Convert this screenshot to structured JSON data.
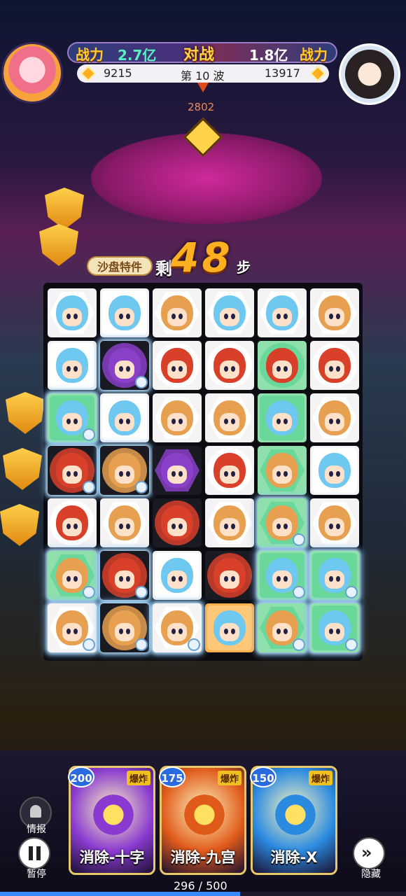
{
  "hud": {
    "player_power_label": "战力",
    "player_power_value": "2.7亿",
    "vs_label": "对战",
    "enemy_power_value": "1.8亿",
    "enemy_power_label": "战力",
    "player_score": "9215",
    "wave_label": "第 10 波",
    "enemy_score": "13917",
    "wave_subvalue": "2802"
  },
  "steps": {
    "tag_label": "沙盘特件",
    "prefix": "剩",
    "count": "48",
    "suffix": "步"
  },
  "board": {
    "rows": 7,
    "cols": 6,
    "tiles": [
      [
        {
          "char": "blue-girl",
          "bg": "hex",
          "tile": "white"
        },
        {
          "char": "blue-girl",
          "bg": "square",
          "tile": "white"
        },
        {
          "char": "monkey",
          "bg": "hex",
          "tile": "white"
        },
        {
          "char": "blue-girl",
          "bg": "hex",
          "tile": "white"
        },
        {
          "char": "blue-girl",
          "bg": "hex",
          "tile": "white"
        },
        {
          "char": "monkey",
          "bg": "hex",
          "tile": "white"
        }
      ],
      [
        {
          "char": "blue-girl",
          "bg": "square",
          "tile": "white"
        },
        {
          "char": "purple-knight",
          "bg": "circle",
          "tile": "dark",
          "special": true
        },
        {
          "char": "red-boy",
          "bg": "circle",
          "tile": "white"
        },
        {
          "char": "red-boy",
          "bg": "circle",
          "tile": "white"
        },
        {
          "char": "red-boy",
          "bg": "circle",
          "tile": "green"
        },
        {
          "char": "red-boy",
          "bg": "circle",
          "tile": "white"
        }
      ],
      [
        {
          "char": "blue-girl",
          "bg": "square",
          "tile": "green",
          "special": true
        },
        {
          "char": "blue-girl",
          "bg": "square",
          "tile": "white"
        },
        {
          "char": "monkey",
          "bg": "hex",
          "tile": "white"
        },
        {
          "char": "monkey",
          "bg": "hex",
          "tile": "white"
        },
        {
          "char": "blue-girl",
          "bg": "square",
          "tile": "green"
        },
        {
          "char": "monkey",
          "bg": "hex",
          "tile": "white"
        }
      ],
      [
        {
          "char": "red-boy",
          "bg": "circle",
          "tile": "dark",
          "special": true
        },
        {
          "char": "monkey",
          "bg": "circle",
          "tile": "dark",
          "special": true
        },
        {
          "char": "purple-knight",
          "bg": "hex",
          "tile": "dark"
        },
        {
          "char": "red-boy",
          "bg": "circle",
          "tile": "white"
        },
        {
          "char": "monkey",
          "bg": "hex",
          "tile": "green"
        },
        {
          "char": "blue-girl",
          "bg": "square",
          "tile": "white"
        }
      ],
      [
        {
          "char": "red-boy",
          "bg": "circle",
          "tile": "white"
        },
        {
          "char": "monkey",
          "bg": "hex",
          "tile": "white"
        },
        {
          "char": "red-boy",
          "bg": "circle",
          "tile": "dark"
        },
        {
          "char": "monkey",
          "bg": "hex",
          "tile": "white"
        },
        {
          "char": "monkey",
          "bg": "hex",
          "tile": "green",
          "special": true
        },
        {
          "char": "monkey",
          "bg": "hex",
          "tile": "white"
        }
      ],
      [
        {
          "char": "monkey",
          "bg": "hex",
          "tile": "green",
          "special": true
        },
        {
          "char": "red-boy",
          "bg": "circle",
          "tile": "dark",
          "special": true
        },
        {
          "char": "blue-girl",
          "bg": "square",
          "tile": "white"
        },
        {
          "char": "red-boy",
          "bg": "circle",
          "tile": "dark"
        },
        {
          "char": "blue-girl",
          "bg": "square",
          "tile": "green",
          "special": true
        },
        {
          "char": "blue-girl",
          "bg": "square",
          "tile": "green",
          "special": true
        }
      ],
      [
        {
          "char": "monkey",
          "bg": "hex",
          "tile": "white",
          "special": true
        },
        {
          "char": "monkey",
          "bg": "circle",
          "tile": "dark",
          "special": true
        },
        {
          "char": "monkey",
          "bg": "hex",
          "tile": "white",
          "special": true
        },
        {
          "char": "blue-girl",
          "bg": "square",
          "tile": "orange"
        },
        {
          "char": "monkey",
          "bg": "hex",
          "tile": "green",
          "special": true
        },
        {
          "char": "blue-girl",
          "bg": "square",
          "tile": "green",
          "special": true
        }
      ]
    ]
  },
  "skills": [
    {
      "cost": "200",
      "tag": "爆炸",
      "label": "消除-十字",
      "color": "#8a3ad0"
    },
    {
      "cost": "175",
      "tag": "爆炸",
      "label": "消除-九宫",
      "color": "#e05a1a"
    },
    {
      "cost": "150",
      "tag": "爆炸",
      "label": "消除-X",
      "color": "#2a8ae0"
    }
  ],
  "side": {
    "info_label": "情报",
    "pause_label": "暂停",
    "hide_label": "隐藏"
  },
  "progress": {
    "text": "296 / 500",
    "fraction": 0.592
  },
  "colors": {
    "blue-girl": "#6ec8f0",
    "red-boy": "#d8402a",
    "monkey": "#e6a050",
    "purple-knight": "#8a40c8"
  }
}
